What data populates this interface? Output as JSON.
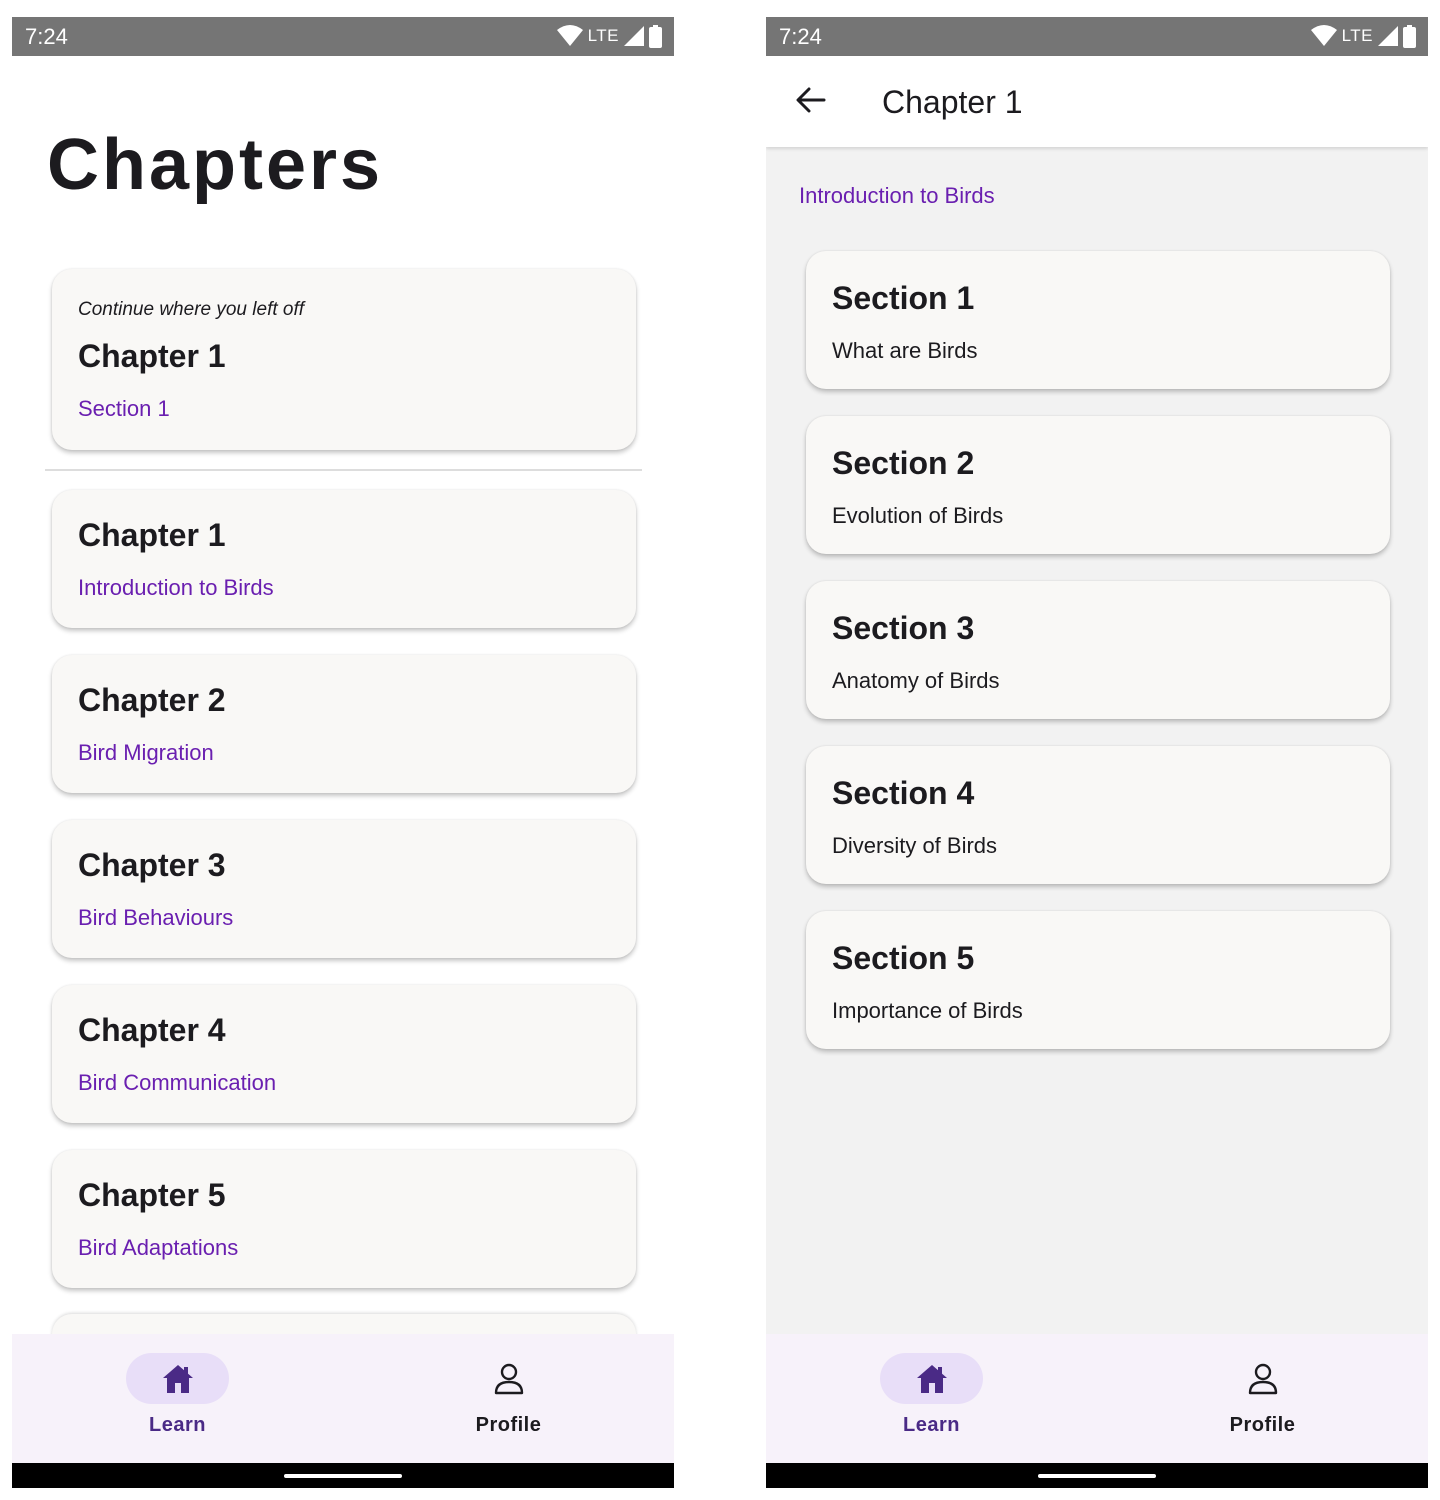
{
  "colors": {
    "status_bar": "#757575",
    "accent_purple": "#6a1fb0",
    "nav_background": "#f7f2fa",
    "nav_active_pill": "#e8def8",
    "card_background": "#f9f8f6",
    "detail_background": "#f2f2f2"
  },
  "status_bar": {
    "time": "7:24",
    "network": "LTE",
    "icons": [
      "wifi-icon",
      "cell-signal-icon",
      "battery-icon"
    ]
  },
  "chapters_screen": {
    "title": "Chapters",
    "continue_card": {
      "caption": "Continue where you left off",
      "chapter": "Chapter 1",
      "section": "Section 1"
    },
    "chapters": [
      {
        "title": "Chapter 1",
        "subtitle": "Introduction to Birds"
      },
      {
        "title": "Chapter 2",
        "subtitle": "Bird Migration"
      },
      {
        "title": "Chapter 3",
        "subtitle": "Bird Behaviours"
      },
      {
        "title": "Chapter 4",
        "subtitle": "Bird Communication"
      },
      {
        "title": "Chapter 5",
        "subtitle": "Bird Adaptations"
      }
    ]
  },
  "chapter_detail_screen": {
    "back_icon": "arrow-back-icon",
    "title": "Chapter 1",
    "chapter_name": "Introduction to Birds",
    "sections": [
      {
        "title": "Section 1",
        "description": "What are Birds"
      },
      {
        "title": "Section 2",
        "description": "Evolution of Birds"
      },
      {
        "title": "Section 3",
        "description": "Anatomy of Birds"
      },
      {
        "title": "Section 4",
        "description": "Diversity of Birds"
      },
      {
        "title": "Section 5",
        "description": "Importance of Birds"
      }
    ]
  },
  "bottom_nav": {
    "items": [
      {
        "label": "Learn",
        "icon": "home-icon",
        "active": true
      },
      {
        "label": "Profile",
        "icon": "person-icon",
        "active": false
      }
    ]
  }
}
